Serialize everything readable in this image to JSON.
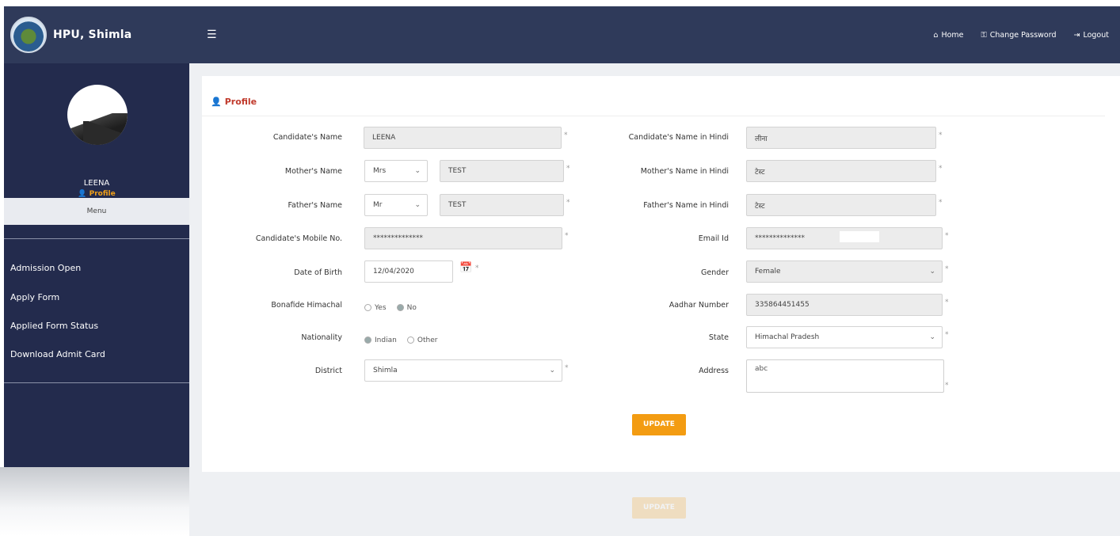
{
  "app": {
    "brand": "HPU, Shimla",
    "menu_icon": "hamburger-icon"
  },
  "toplinks": [
    {
      "label": "Home",
      "icon": "home-icon"
    },
    {
      "label": "Change Password",
      "icon": "key-icon"
    },
    {
      "label": "Logout",
      "icon": "logout-icon"
    }
  ],
  "sidebar": {
    "user": "LEENA",
    "profile_link": "Profile",
    "menu_label": "Menu",
    "items": [
      "Admission Open",
      "Apply Form",
      "Applied Form Status",
      "Download Admit Card"
    ]
  },
  "profile": {
    "title": "Profile",
    "candidate_name_label": "Candidate's Name",
    "candidate_name": "LEENA",
    "candidate_name_hindi_label": "Candidate's Name in Hindi",
    "candidate_name_hindi": "लीना",
    "mother_label": "Mother's Name",
    "mother_prefix": "Mrs",
    "mother_name": "TEST",
    "mother_hindi_label": "Mother's Name in Hindi",
    "mother_hindi": "टेस्ट",
    "father_label": "Father's Name",
    "father_prefix": "Mr",
    "father_name": "TEST",
    "father_hindi_label": "Father's Name in Hindi",
    "father_hindi": "टेस्ट",
    "mobile_label": "Candidate's Mobile No.",
    "mobile": "**************",
    "email_label": "Email Id",
    "email": "**************",
    "dob_label": "Date of Birth",
    "dob": "12/04/2020",
    "gender_label": "Gender",
    "gender": "Female",
    "himachal_label": "Bonafide Himachal",
    "himachal_yes": "Yes",
    "himachal_no": "No",
    "aadhar_label": "Aadhar Number",
    "aadhar": "335864451455",
    "nationality_label": "Nationality",
    "nationality_indian": "Indian",
    "nationality_other": "Other",
    "state_label": "State",
    "state": "Himachal Pradesh",
    "district_label": "District",
    "district": "Shimla",
    "address_label": "Address",
    "address": "abc",
    "update": "UPDATE"
  },
  "colors": {
    "topbar": "#2f3a5a",
    "sidebar": "#232b4d",
    "accent": "#f39c12",
    "title": "#c0392b"
  }
}
